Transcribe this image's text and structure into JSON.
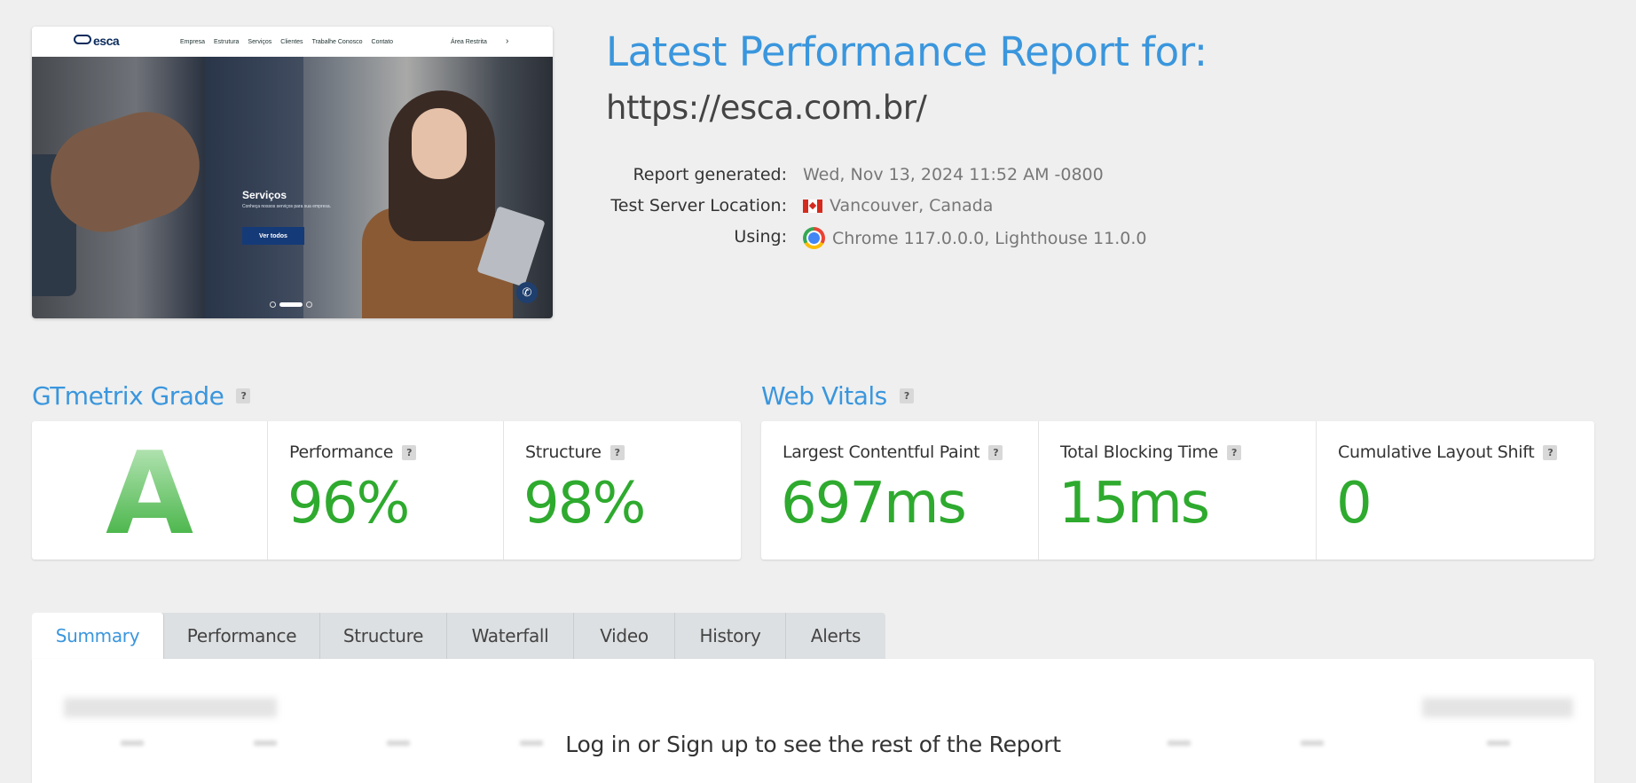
{
  "screenshot": {
    "logo": "esca",
    "nav_links": [
      "Empresa",
      "Estrutura",
      "Serviços",
      "Clientes",
      "Trabalhe Conosco",
      "Contato"
    ],
    "area_link": "Área Restrita",
    "hero_title": "Serviços",
    "hero_subtitle": "Conheça nossos serviços para sua empresa.",
    "hero_button": "Ver todos"
  },
  "report": {
    "title": "Latest Performance Report for:",
    "url": "https://esca.com.br/",
    "generated_label": "Report generated:",
    "generated_value": "Wed, Nov 13, 2024 11:52 AM -0800",
    "location_label": "Test Server Location:",
    "location_value": "Vancouver, Canada",
    "using_label": "Using:",
    "using_value": "Chrome 117.0.0.0, Lighthouse 11.0.0"
  },
  "grade": {
    "heading": "GTmetrix Grade",
    "letter": "A",
    "performance_label": "Performance",
    "performance_value": "96%",
    "structure_label": "Structure",
    "structure_value": "98%"
  },
  "vitals": {
    "heading": "Web Vitals",
    "lcp_label": "Largest Contentful Paint",
    "lcp_value": "697ms",
    "tbt_label": "Total Blocking Time",
    "tbt_value": "15ms",
    "cls_label": "Cumulative Layout Shift",
    "cls_value": "0"
  },
  "help_glyph": "?",
  "tabs": [
    "Summary",
    "Performance",
    "Structure",
    "Waterfall",
    "Video",
    "History",
    "Alerts"
  ],
  "active_tab": "Summary",
  "panel": {
    "login_message": "Log in or Sign up to see the rest of the Report"
  },
  "colors": {
    "accent": "#3a96dd",
    "good": "#2eaa2e",
    "background": "#efefef"
  }
}
